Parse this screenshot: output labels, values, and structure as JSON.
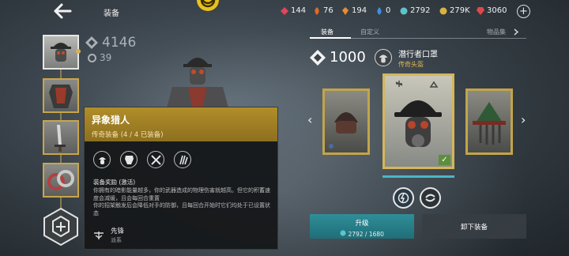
{
  "header": {
    "title": "装备",
    "resources": [
      {
        "name": "red-gem",
        "value": "144",
        "color": "#e0455a"
      },
      {
        "name": "orange-flame",
        "value": "76",
        "color": "#e06a2a"
      },
      {
        "name": "orange-crystal",
        "value": "194",
        "color": "#e88d2f"
      },
      {
        "name": "blue-drop",
        "value": "0",
        "color": "#3c8fe0"
      },
      {
        "name": "cyan-coin",
        "value": "2792",
        "color": "#5ec4c9"
      },
      {
        "name": "gold-coin",
        "value": "279K",
        "color": "#d9b341"
      },
      {
        "name": "red-ruby",
        "value": "3060",
        "color": "#e24747"
      }
    ],
    "plus": "+"
  },
  "character": {
    "power": "4146",
    "level": "39"
  },
  "tooltip": {
    "title": "异象猎人",
    "subtitle": "传奇装备 (4 / 4 已装备)",
    "section": "装备奖励 (激活)",
    "desc1": "你拥有的暗影能量越多，你的武器造成的物理伤害就越高。但它的积蓄速度会减缓，且会每回合重置",
    "desc2": "你的招架触发后会降低对手的防御，且每回合开始时它们均处于已设置状态",
    "faction_name": "先锋",
    "faction_kind": "派系",
    "icons": [
      "helmet-icon",
      "armor-icon",
      "crossed-swords-icon",
      "claws-icon"
    ]
  },
  "panel": {
    "tabs": [
      "装备",
      "自定义",
      "物品集"
    ],
    "power": "1000",
    "item_name": "潜行者口罩",
    "item_rarity": "传奇头盔",
    "upgrade_label": "升级",
    "upgrade_cost": "2792 / 1680",
    "unequip_label": "卸下装备"
  },
  "colors": {
    "accent_gold": "#c2a44b",
    "accent_teal": "#2f8e98"
  }
}
